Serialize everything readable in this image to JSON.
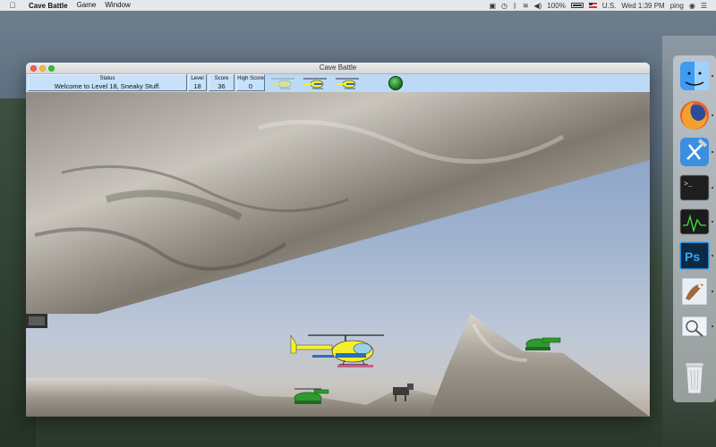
{
  "menubar": {
    "app_name": "Cave Battle",
    "menus": [
      "Game",
      "Window"
    ],
    "battery": "100%",
    "input_source": "U.S.",
    "clock": "Wed 1:39 PM",
    "user": "ping"
  },
  "window": {
    "title": "Cave Battle"
  },
  "hud": {
    "status_label": "Status",
    "status_text": "Welcome to Level 18, Sneaky Stuff.",
    "level_label": "Level",
    "level_value": "18",
    "score_label": "Score",
    "score_value": "36",
    "high_label": "High Score",
    "high_value": "0"
  },
  "dock": {
    "apps": [
      "finder-icon",
      "firefox-icon",
      "xcode-icon",
      "terminal-icon",
      "activity-monitor-icon",
      "photoshop-icon",
      "mail-icon",
      "preview-icon",
      "trash-icon"
    ],
    "terminal_glyph": ">_",
    "photoshop_text": "Ps"
  },
  "colors": {
    "hud_background": "#bcd9f5",
    "helicopter_body": "#f4ef2a",
    "helicopter_stripe": "#2a6fb8",
    "tank_green": "#2f9a2f"
  }
}
